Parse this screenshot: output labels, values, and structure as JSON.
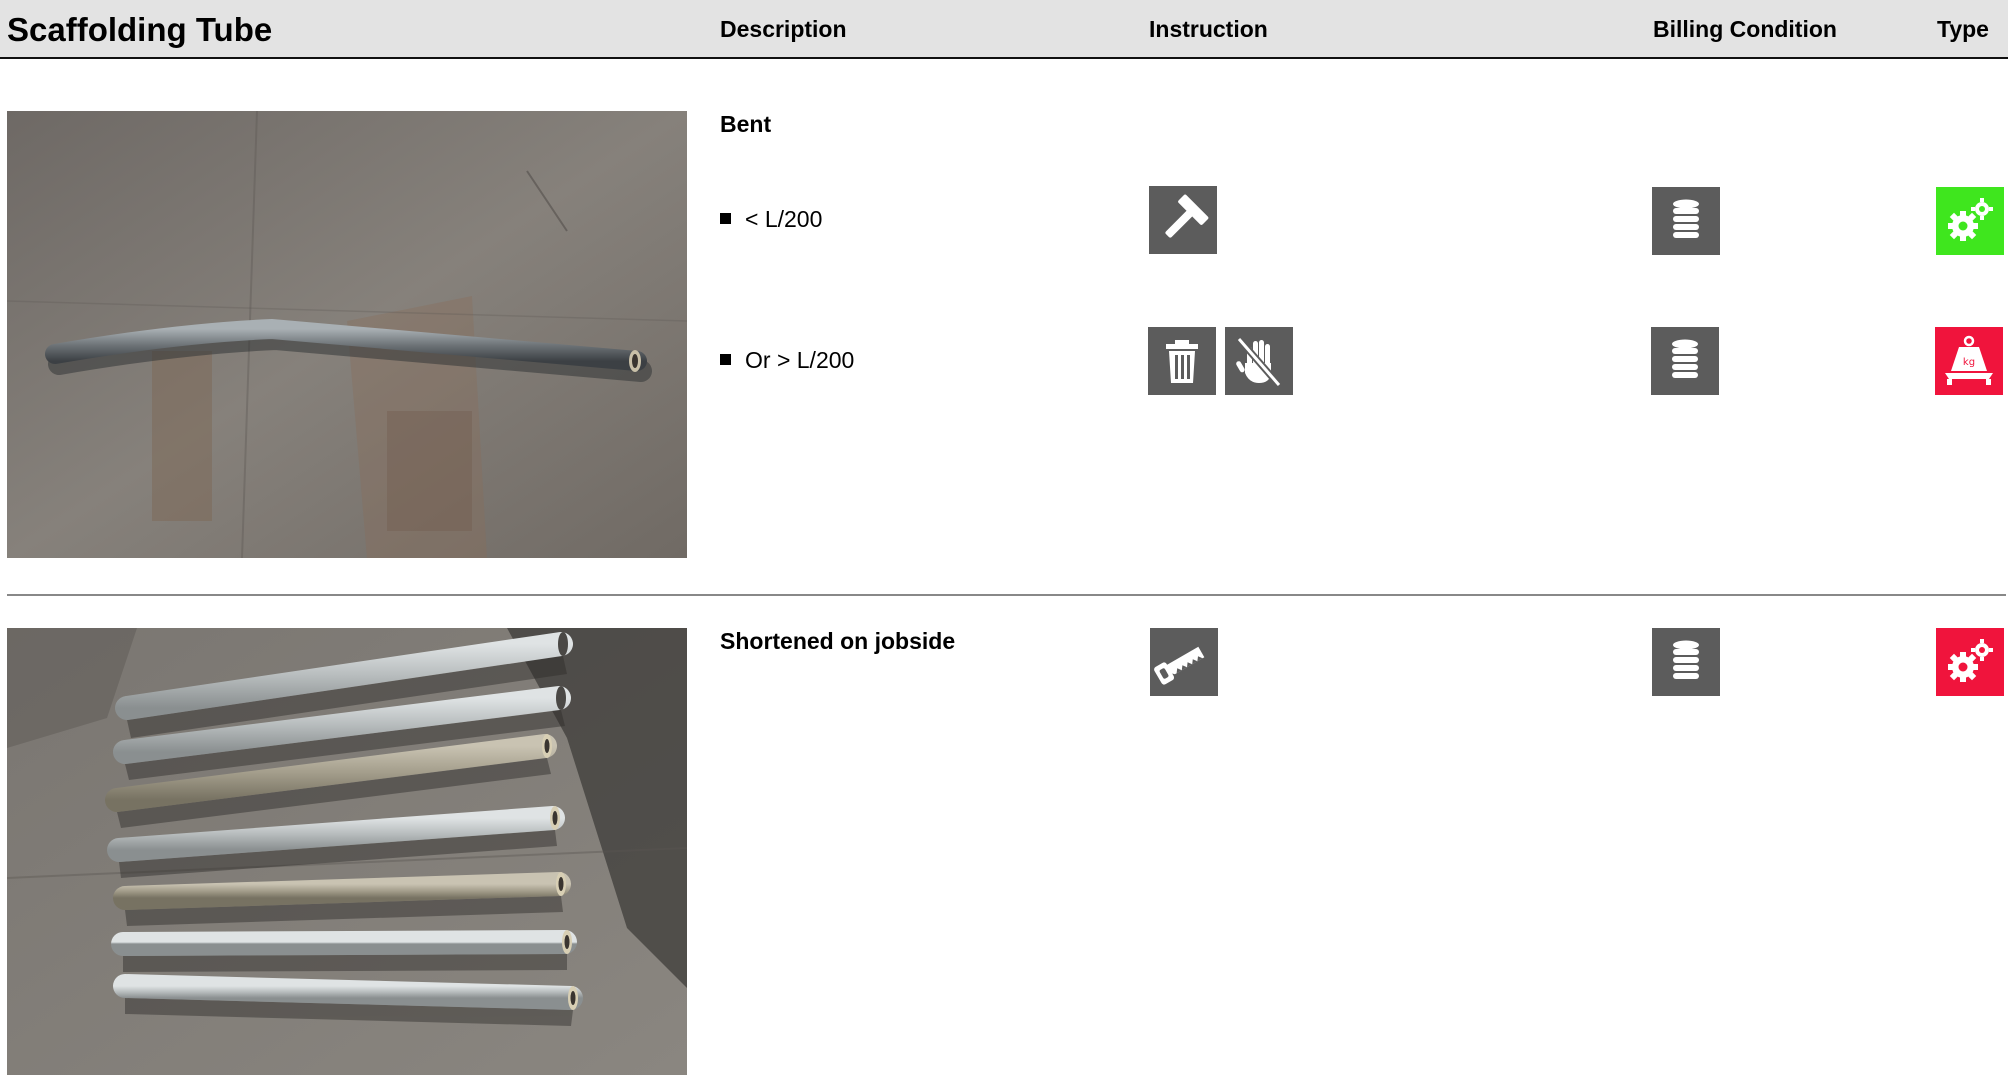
{
  "header": {
    "title": "Scaffolding Tube",
    "description": "Description",
    "instruction": "Instruction",
    "billing_condition": "Billing Condition",
    "type": "Type"
  },
  "sections": [
    {
      "title": "Bent",
      "rows": [
        {
          "text": "< L/200",
          "instruction_icons": [
            "hammer-icon"
          ],
          "billing_icon": "coin-stack-icon",
          "type_icon": "gears-icon",
          "type_color": "#3fe61e"
        },
        {
          "text": "Or > L/200",
          "instruction_icons": [
            "trash-icon",
            "no-touch-hand-icon"
          ],
          "billing_icon": "coin-stack-icon",
          "type_icon": "weight-kg-icon",
          "type_color": "#f0143c"
        }
      ]
    },
    {
      "title": "Shortened on jobside",
      "rows": [
        {
          "text": "",
          "instruction_icons": [
            "saw-icon"
          ],
          "billing_icon": "coin-stack-icon",
          "type_icon": "gears-icon",
          "type_color": "#f0143c"
        }
      ]
    }
  ],
  "colors": {
    "header_bg": "#e3e3e3",
    "icon_grey": "#5c5c5c",
    "ok_green": "#3fe61e",
    "alert_red": "#f0143c"
  }
}
